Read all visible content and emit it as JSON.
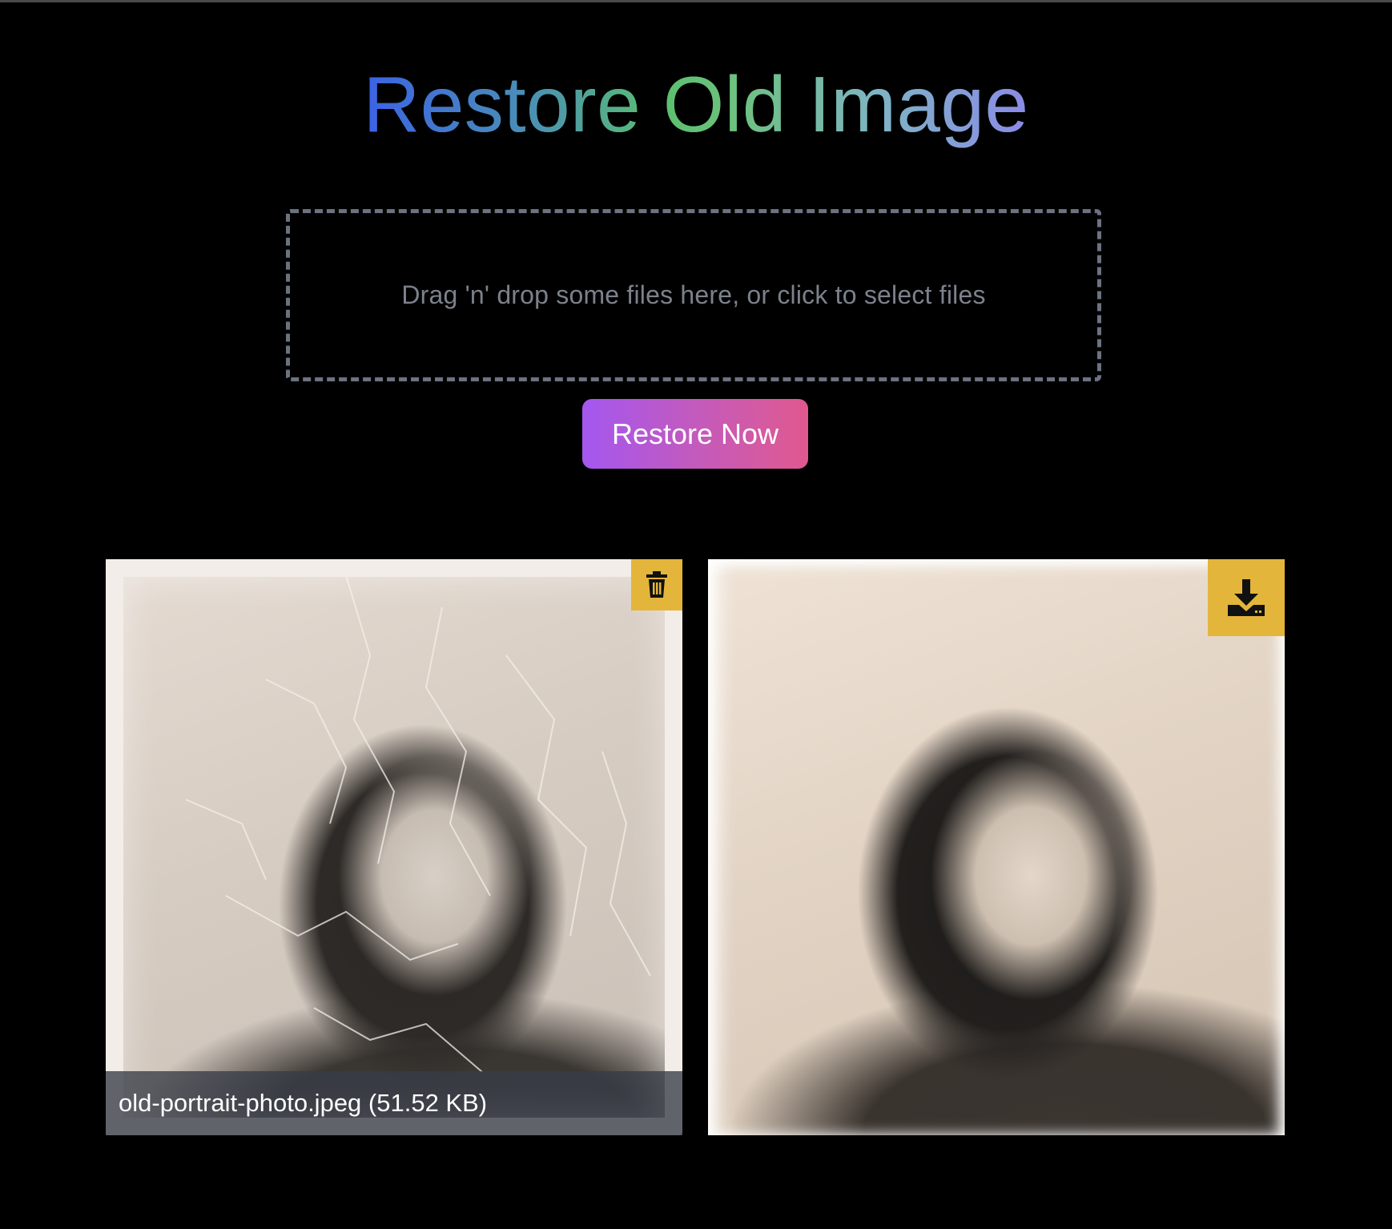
{
  "page": {
    "title": "Restore Old Image"
  },
  "dropzone": {
    "text": "Drag 'n' drop some files here, or click to select files"
  },
  "actions": {
    "restore_label": "Restore Now"
  },
  "original_image": {
    "caption": "old-portrait-photo.jpeg (51.52 KB)",
    "delete_icon": "trash-icon"
  },
  "restored_image": {
    "download_icon": "download-icon"
  },
  "colors": {
    "background": "#000000",
    "dropzone_border": "#6b7280",
    "button_gradient_start": "#a457f0",
    "button_gradient_end": "#e0598f",
    "icon_button_bg": "#e3b53a"
  }
}
